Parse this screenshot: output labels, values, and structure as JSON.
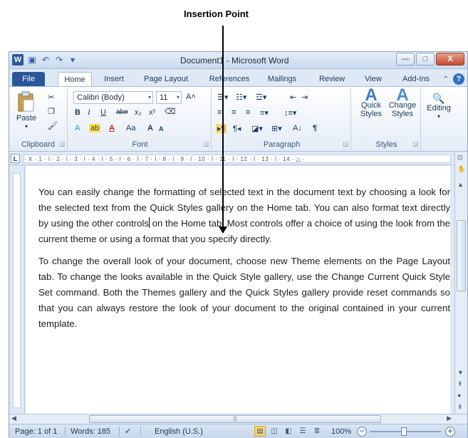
{
  "callout": {
    "label": "Insertion Point"
  },
  "window": {
    "title": "Document1 - Microsoft Word",
    "controls": {
      "minimize": "—",
      "maximize": "□",
      "close": "X"
    }
  },
  "quick_access": {
    "app_icon": "W",
    "save": "▣",
    "undo": "↶",
    "redo": "↷",
    "customize": "▾"
  },
  "tabs": [
    "File",
    "Home",
    "Insert",
    "Page Layout",
    "References",
    "Mailings",
    "Review",
    "View",
    "Add-Ins"
  ],
  "ribbon": {
    "clipboard": {
      "label": "Clipboard",
      "paste": "Paste"
    },
    "font": {
      "label": "Font",
      "font_name": "Calibri (Body)",
      "font_size": "11",
      "bold": "B",
      "italic": "I",
      "underline": "U",
      "strike": "abe",
      "subscript": "x₂",
      "superscript": "x²",
      "grow": "A",
      "shrink": "A",
      "case": "Aa"
    },
    "paragraph": {
      "label": "Paragraph",
      "pilcrow": "¶",
      "sort": "A↓"
    },
    "styles": {
      "label": "Styles",
      "quick_styles": "Quick\nStyles",
      "change_styles": "Change\nStyles"
    },
    "editing": {
      "label": "Editing"
    }
  },
  "ruler": {
    "corner": "L",
    "marks": "· X · 1 · I · 2 · I · 3 · I · 4 · I · 5 · I · 6 · I · 7 · I · 8 · I · 9 · I · 10 · I · 11 · I · 12 · I · 13 · I · 14 · △ ·"
  },
  "document": {
    "para1_before_caret": "You can easily change the formatting of selected text in the document text by choosing a look for the selected text from the Quick Styles gallery on the Home tab. You can also format text directly by using the other controls",
    "para1_after_caret": " on the Home tab. Most controls offer a choice of using the look from the current theme or using a format that you specify directly.",
    "para2": "To change the overall look of your document, choose new Theme elements on the Page Layout tab. To change the looks available in the Quick Style gallery, use the Change Current Quick Style Set command. Both the Themes gallery and the Quick Styles gallery provide reset commands so that you can always restore the look of your document to the original contained in your current template."
  },
  "status": {
    "page": "Page: 1 of 1",
    "words": "Words: 185",
    "language": "English (U.S.)",
    "zoom": "100%",
    "zoom_minus": "−",
    "zoom_plus": "+"
  }
}
